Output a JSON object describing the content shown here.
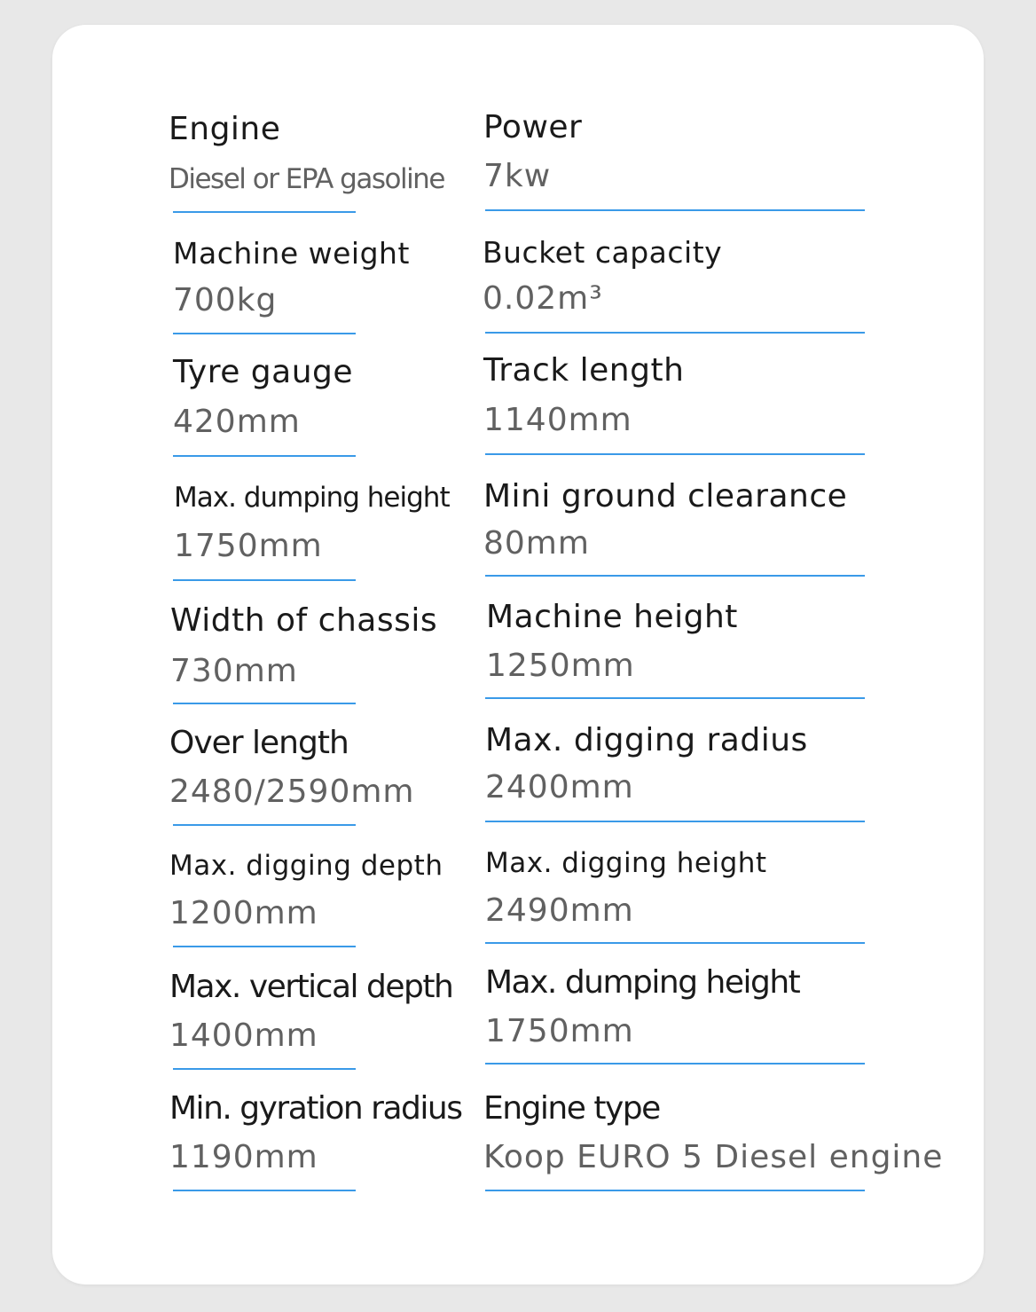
{
  "specs": [
    {
      "label": "Engine",
      "value": "Diesel or EPA gasoline"
    },
    {
      "label": "Power",
      "value": "7kw"
    },
    {
      "label": "Machine weight",
      "value": "700kg"
    },
    {
      "label": "Bucket capacity",
      "value": "0.02m³"
    },
    {
      "label": "Tyre gauge",
      "value": "420mm"
    },
    {
      "label": "Track length",
      "value": "1140mm"
    },
    {
      "label": "Max. dumping height",
      "value": "1750mm"
    },
    {
      "label": "Mini ground clearance",
      "value": "80mm"
    },
    {
      "label": "Width of chassis",
      "value": "730mm"
    },
    {
      "label": "Machine height",
      "value": "1250mm"
    },
    {
      "label": "Over length",
      "value": "2480/2590mm"
    },
    {
      "label": "Max. digging radius",
      "value": "2400mm"
    },
    {
      "label": "Max. digging depth",
      "value": "1200mm"
    },
    {
      "label": "Max. digging height",
      "value": "2490mm"
    },
    {
      "label": "Max. vertical depth",
      "value": "1400mm"
    },
    {
      "label": "Max. dumping height",
      "value": "1750mm"
    },
    {
      "label": "Min. gyration radius",
      "value": "1190mm"
    },
    {
      "label": "Engine type",
      "value": "Koop EURO 5 Diesel engine"
    }
  ],
  "colors": {
    "background": "#e8e8e8",
    "card": "#ffffff",
    "label": "#1a1a1a",
    "value": "#616161",
    "underline": "#3a9ae8"
  }
}
